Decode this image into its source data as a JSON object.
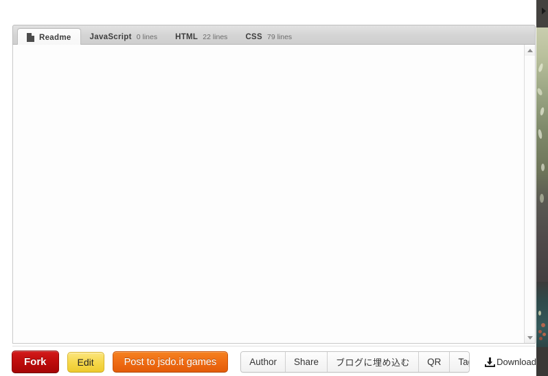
{
  "window": {
    "background_color": "#ffffff"
  },
  "cursor_marker": {
    "icon": "play-triangle-right-icon"
  },
  "tabs": [
    {
      "id": "readme",
      "label": "Readme",
      "lines": "",
      "icon": "file-document-icon",
      "active": true
    },
    {
      "id": "javascript",
      "label": "JavaScript",
      "lines": "0 lines",
      "icon": "",
      "active": false
    },
    {
      "id": "html",
      "label": "HTML",
      "lines": "22 lines",
      "icon": "",
      "active": false
    },
    {
      "id": "css",
      "label": "CSS",
      "lines": "79 lines",
      "icon": "",
      "active": false
    }
  ],
  "content": {
    "text": ""
  },
  "scrollbar": {
    "up_arrow_icon": "triangle-up-icon",
    "down_arrow_icon": "triangle-down-icon"
  },
  "toolbar": {
    "fork_label": "Fork",
    "edit_label": "Edit",
    "post_label": "Post to jsdo.it games",
    "group": [
      {
        "id": "author",
        "label": "Author"
      },
      {
        "id": "share",
        "label": "Share"
      },
      {
        "id": "embed",
        "label": "ブログに埋め込む"
      },
      {
        "id": "qr",
        "label": "QR"
      },
      {
        "id": "tag",
        "label": "Tag"
      }
    ],
    "download_label": "Download",
    "download_icon": "download-tray-icon"
  },
  "colors": {
    "fork_red": "#c00d0d",
    "edit_yellow": "#f6d84c",
    "post_orange": "#ef6c14",
    "tabbar_gray": "#d4d4d4",
    "panel_white": "#fdfdfd"
  }
}
